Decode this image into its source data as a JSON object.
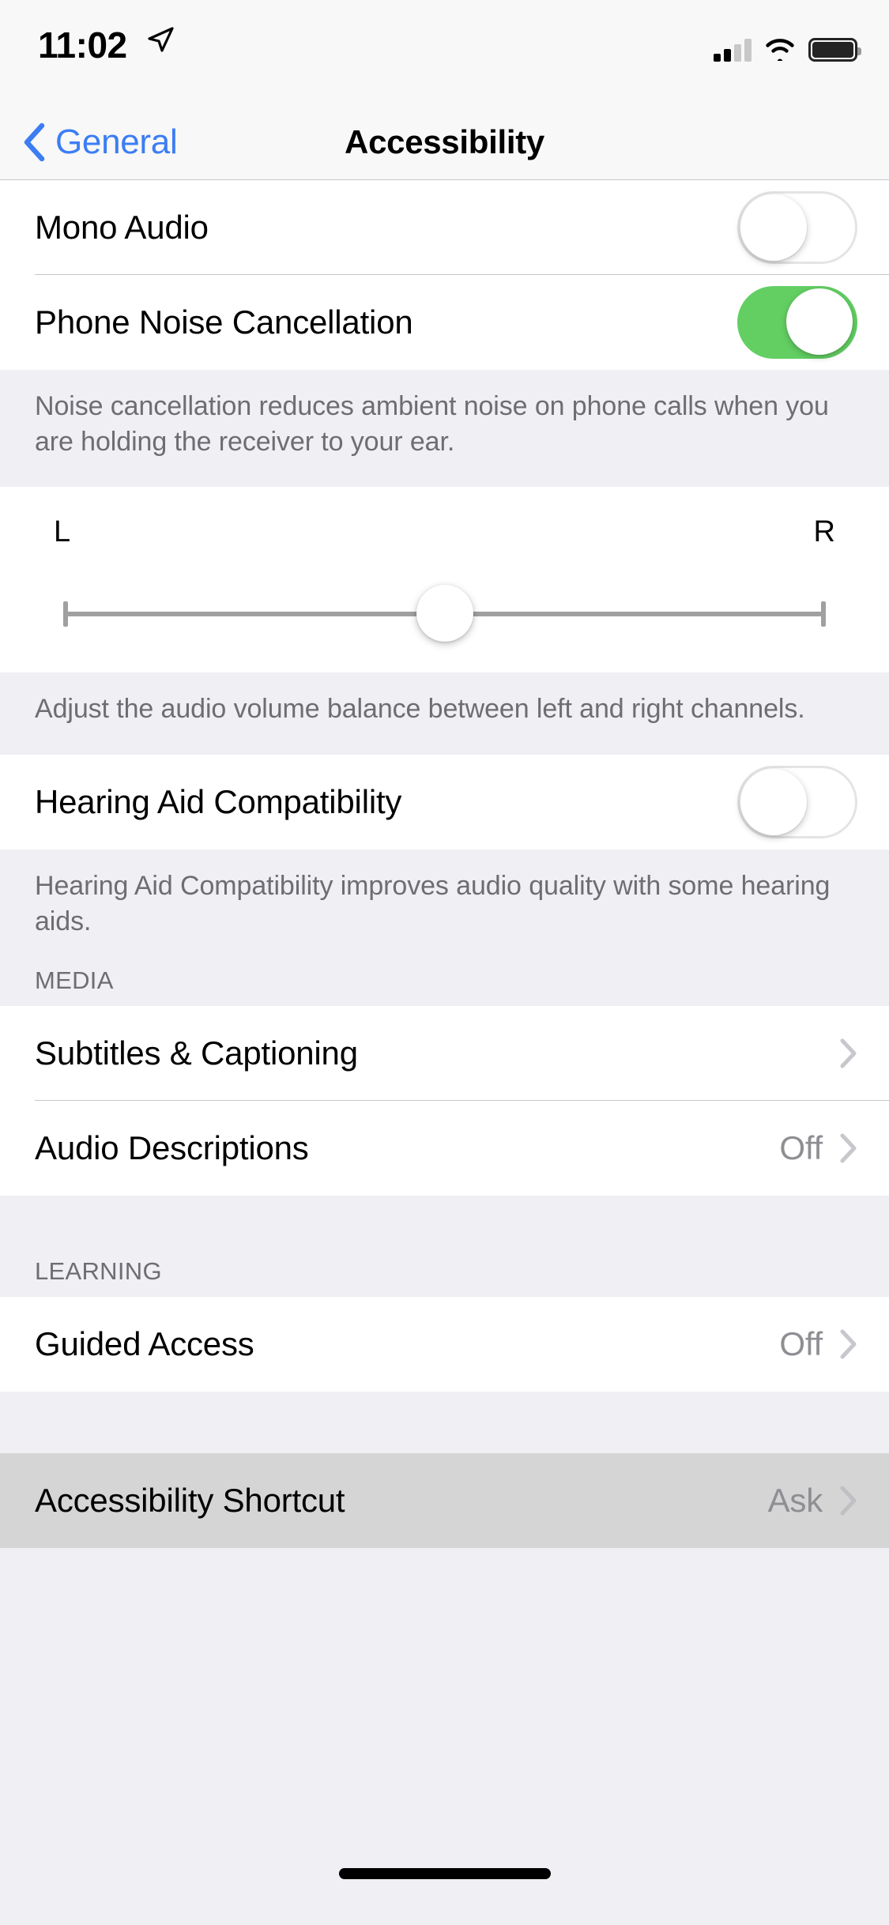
{
  "status_bar": {
    "time": "11:02",
    "location_icon": "location-arrow-icon",
    "cellular_icon": "cellular-signal-icon",
    "wifi_icon": "wifi-icon",
    "battery_icon": "battery-full-icon"
  },
  "nav": {
    "back_label": "General",
    "back_icon": "chevron-left-icon",
    "title": "Accessibility"
  },
  "sections": {
    "audio": {
      "rows": [
        {
          "label": "Mono Audio",
          "toggle": "off"
        },
        {
          "label": "Phone Noise Cancellation",
          "toggle": "on"
        }
      ],
      "footer": "Noise cancellation reduces ambient noise on phone calls when you are holding the receiver to your ear."
    },
    "balance": {
      "left_label": "L",
      "right_label": "R",
      "value": 50,
      "footer": "Adjust the audio volume balance between left and right channels."
    },
    "hearing": {
      "rows": [
        {
          "label": "Hearing Aid Compatibility",
          "toggle": "off"
        }
      ],
      "footer": "Hearing Aid Compatibility improves audio quality with some hearing aids."
    },
    "media": {
      "header": "MEDIA",
      "rows": [
        {
          "label": "Subtitles & Captioning",
          "value": ""
        },
        {
          "label": "Audio Descriptions",
          "value": "Off"
        }
      ]
    },
    "learning": {
      "header": "LEARNING",
      "rows": [
        {
          "label": "Guided Access",
          "value": "Off"
        }
      ]
    },
    "shortcut": {
      "rows": [
        {
          "label": "Accessibility Shortcut",
          "value": "Ask"
        }
      ]
    }
  },
  "colors": {
    "accent_blue": "#3C7DF4",
    "toggle_on_green": "#63CF63",
    "group_background": "#EFEFF4",
    "row_background": "#FFFFFF",
    "secondary_text": "#8E8E93",
    "footer_text": "#6D6D72",
    "separator": "#C8C7CC",
    "pressed_row": "#D5D5D5"
  }
}
